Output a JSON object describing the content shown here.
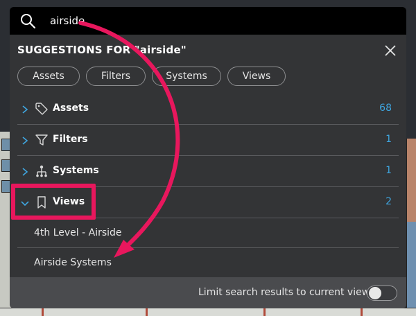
{
  "search": {
    "value": "airside"
  },
  "panel": {
    "title": "SUGGESTIONS FOR \"airside\"",
    "chips": [
      "Assets",
      "Filters",
      "Systems",
      "Views"
    ],
    "rows": [
      {
        "label": "Assets",
        "count": "68",
        "icon": "tag-icon",
        "expanded": false
      },
      {
        "label": "Filters",
        "count": "1",
        "icon": "funnel-icon",
        "expanded": false
      },
      {
        "label": "Systems",
        "count": "1",
        "icon": "hierarchy-icon",
        "expanded": false
      },
      {
        "label": "Views",
        "count": "2",
        "icon": "bookmark-icon",
        "expanded": true
      }
    ],
    "view_results": [
      "4th Level - Airside",
      "Airside Systems"
    ]
  },
  "footer": {
    "label": "Limit search results to current view",
    "toggle_on": false
  },
  "colors": {
    "accent_count": "#3fa6e0",
    "annotation": "#e8175d",
    "panel_bg": "#333436"
  }
}
